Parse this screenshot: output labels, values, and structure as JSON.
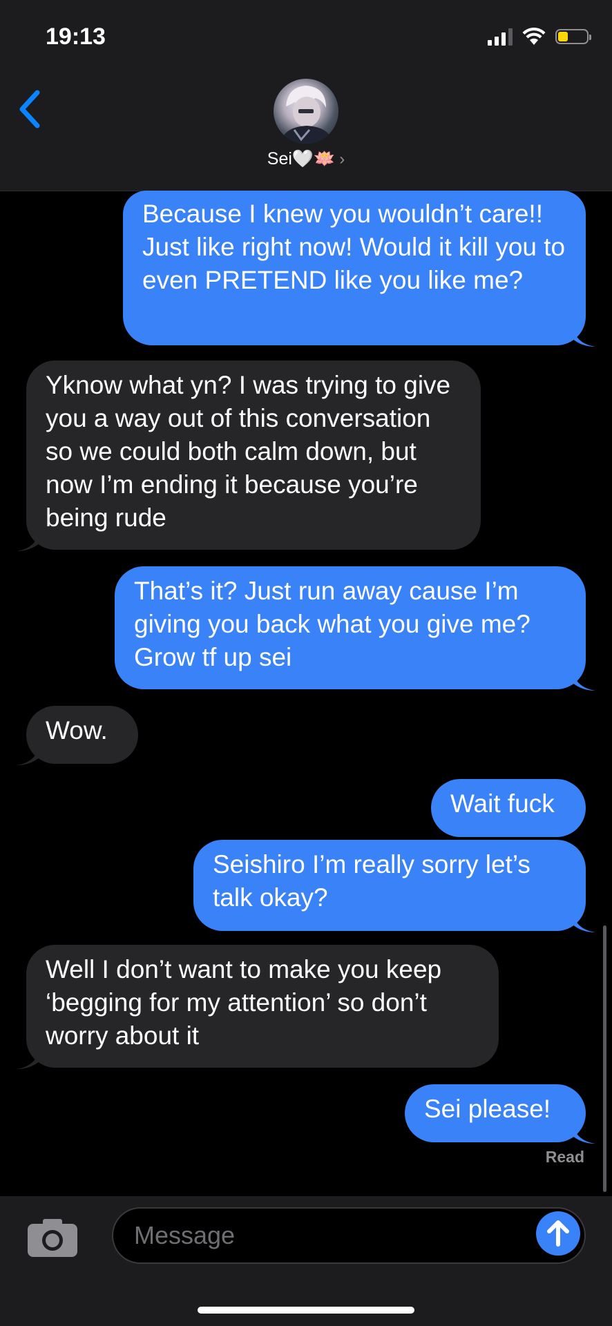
{
  "status_bar": {
    "time": "19:13",
    "battery_level": 0.35,
    "battery_color": "#ffd60a"
  },
  "header": {
    "back_icon": "chevron-left-icon",
    "contact_name": "Sei🤍🪷",
    "chevron": "›"
  },
  "messages": [
    {
      "direction": "sent",
      "text": "Because I knew you wouldn’t care!! Just like right now! Would it kill you to even PRETEND like you like me?"
    },
    {
      "direction": "received",
      "text": "Yknow what yn? I was trying to give you a way out of this conversation so we could both calm down, but now I’m ending it because you’re being rude"
    },
    {
      "direction": "sent",
      "text": "That’s it? Just run away cause I’m giving you back what you give me? Grow tf up sei"
    },
    {
      "direction": "received",
      "text": "Wow."
    },
    {
      "direction": "sent",
      "text": "Wait fuck"
    },
    {
      "direction": "sent",
      "text": "Seishiro I’m really sorry let’s talk okay?"
    },
    {
      "direction": "received",
      "text": "Well I don’t want to make you keep ‘begging for my attention’ so don’t worry about it"
    },
    {
      "direction": "sent",
      "text": "Sei please!"
    }
  ],
  "read_receipt": "Read",
  "composer": {
    "placeholder": "Message",
    "camera_icon": "camera-icon",
    "send_icon": "arrow-up-icon"
  },
  "colors": {
    "sent_bubble": "#3a82f7",
    "received_bubble": "#262629",
    "accent": "#0a84ff"
  }
}
